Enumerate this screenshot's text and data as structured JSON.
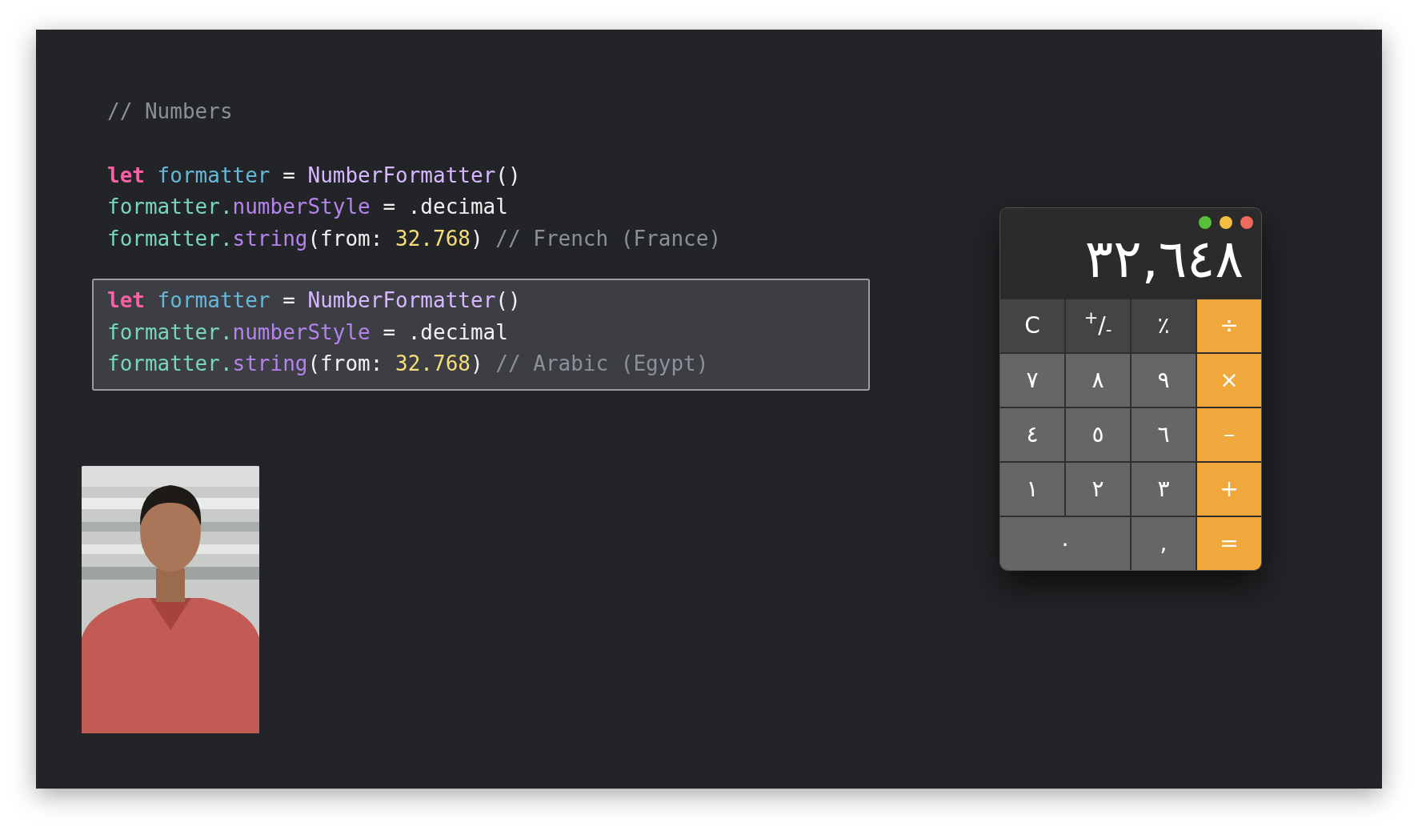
{
  "code": {
    "comment": "// Numbers",
    "blocks": [
      {
        "highlighted": false,
        "lines": [
          [
            {
              "text": "let",
              "kind": "keyword"
            },
            {
              "text": " formatter",
              "kind": "declaration"
            },
            {
              "text": " = ",
              "kind": "plain"
            },
            {
              "text": "NumberFormatter",
              "kind": "type"
            },
            {
              "text": "()",
              "kind": "plain"
            }
          ],
          [
            {
              "text": "formatter.",
              "kind": "variable"
            },
            {
              "text": "numberStyle",
              "kind": "member"
            },
            {
              "text": " = .decimal",
              "kind": "plain"
            }
          ],
          [
            {
              "text": "formatter.",
              "kind": "variable"
            },
            {
              "text": "string",
              "kind": "member"
            },
            {
              "text": "(from: ",
              "kind": "plain"
            },
            {
              "text": "32.768",
              "kind": "number"
            },
            {
              "text": ") ",
              "kind": "plain"
            },
            {
              "text": "// French (France)",
              "kind": "comment"
            }
          ]
        ]
      },
      {
        "highlighted": true,
        "lines": [
          [
            {
              "text": "let",
              "kind": "keyword"
            },
            {
              "text": " formatter",
              "kind": "declaration"
            },
            {
              "text": " = ",
              "kind": "plain"
            },
            {
              "text": "NumberFormatter",
              "kind": "type"
            },
            {
              "text": "()",
              "kind": "plain"
            }
          ],
          [
            {
              "text": "formatter.",
              "kind": "variable"
            },
            {
              "text": "numberStyle",
              "kind": "member"
            },
            {
              "text": " = .decimal",
              "kind": "plain"
            }
          ],
          [
            {
              "text": "formatter.",
              "kind": "variable"
            },
            {
              "text": "string",
              "kind": "member"
            },
            {
              "text": "(from: ",
              "kind": "plain"
            },
            {
              "text": "32.768",
              "kind": "number"
            },
            {
              "text": ") ",
              "kind": "plain"
            },
            {
              "text": "// Arabic (Egypt)",
              "kind": "comment"
            }
          ]
        ]
      }
    ]
  },
  "calculator": {
    "display": "٣٢,٦٤٨",
    "keys": [
      {
        "label": "÷",
        "kind": "operator"
      },
      {
        "label": "٪",
        "kind": "function"
      },
      {
        "label": "$^{+}$/$_{-}$",
        "kind": "function"
      },
      {
        "label": "C",
        "kind": "function"
      },
      {
        "label": "×",
        "kind": "operator"
      },
      {
        "label": "٩",
        "kind": "digit"
      },
      {
        "label": "٨",
        "kind": "digit"
      },
      {
        "label": "٧",
        "kind": "digit"
      },
      {
        "label": "–",
        "kind": "operator"
      },
      {
        "label": "٦",
        "kind": "digit"
      },
      {
        "label": "٥",
        "kind": "digit"
      },
      {
        "label": "٤",
        "kind": "digit"
      },
      {
        "label": "+",
        "kind": "operator"
      },
      {
        "label": "٣",
        "kind": "digit"
      },
      {
        "label": "٢",
        "kind": "digit"
      },
      {
        "label": "١",
        "kind": "digit"
      },
      {
        "label": "=",
        "kind": "operator"
      },
      {
        "label": ",",
        "kind": "digit"
      },
      {
        "label": "٠",
        "kind": "wide-digit"
      }
    ]
  }
}
